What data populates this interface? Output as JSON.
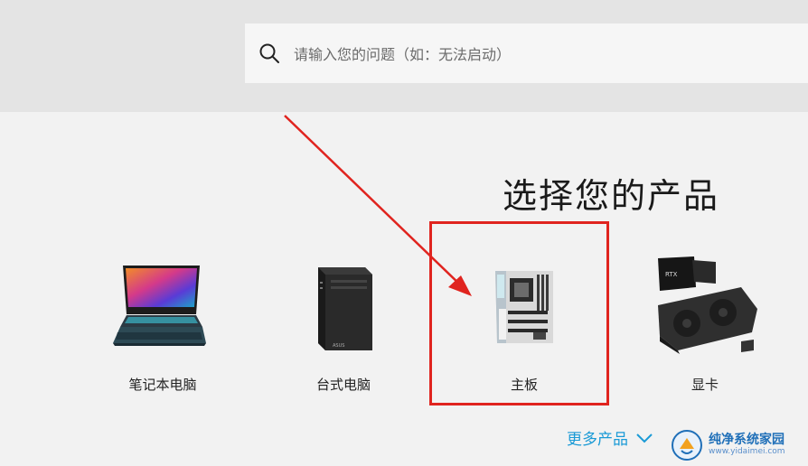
{
  "search": {
    "placeholder": "请输入您的问题（如：无法启动）"
  },
  "heading": "选择您的产品",
  "products": [
    {
      "label": "笔记本电脑",
      "icon": "laptop-icon"
    },
    {
      "label": "台式电脑",
      "icon": "desktop-tower-icon"
    },
    {
      "label": "主板",
      "icon": "motherboard-icon"
    },
    {
      "label": "显卡",
      "icon": "graphics-card-icon"
    }
  ],
  "more": {
    "label": "更多产品"
  },
  "annotation": {
    "color": "#e0241f"
  },
  "watermark": {
    "title": "纯净系统家园",
    "url": "www.yidaimei.com"
  },
  "colors": {
    "accent": "#1a9ad6",
    "background": "#f2f2f2",
    "header_band": "#e4e4e4"
  }
}
